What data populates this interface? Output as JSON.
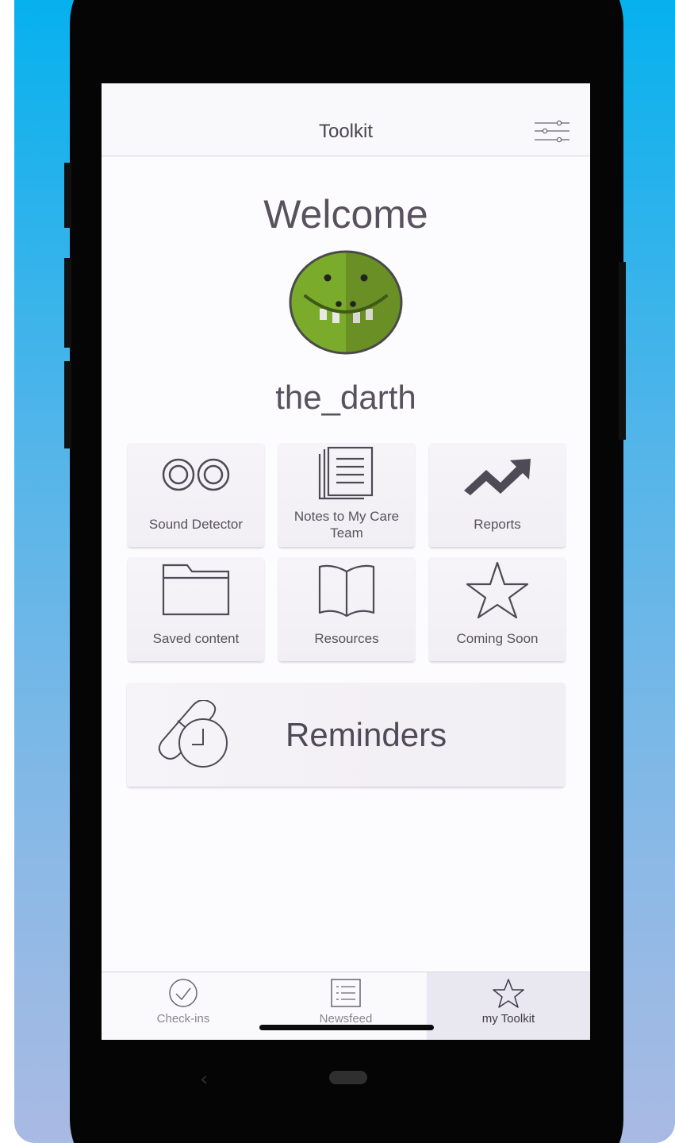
{
  "header": {
    "title": "Toolkit"
  },
  "welcome": {
    "heading": "Welcome",
    "username": "the_darth"
  },
  "tools": [
    {
      "label": "Sound Detector",
      "icon": "voicemail-icon"
    },
    {
      "label": "Notes to My Care Team",
      "icon": "notes-icon"
    },
    {
      "label": "Reports",
      "icon": "trending-up-icon"
    },
    {
      "label": "Saved content",
      "icon": "folder-icon"
    },
    {
      "label": "Resources",
      "icon": "book-icon"
    },
    {
      "label": "Coming Soon",
      "icon": "star-icon"
    }
  ],
  "reminders": {
    "label": "Reminders",
    "icon": "pill-clock-icon"
  },
  "tabs": [
    {
      "label": "Check-ins",
      "icon": "check-circle-icon",
      "active": false
    },
    {
      "label": "Newsfeed",
      "icon": "list-icon",
      "active": false
    },
    {
      "label": "my Toolkit",
      "icon": "star-icon",
      "active": true
    }
  ],
  "colors": {
    "background_top": "#06b1ee",
    "background_bottom": "#a9bae3",
    "text": "#57525d",
    "avatar_green": "#7bab2b",
    "avatar_green_dark": "#6a8f25",
    "active_tab": "#e9e7f0"
  }
}
